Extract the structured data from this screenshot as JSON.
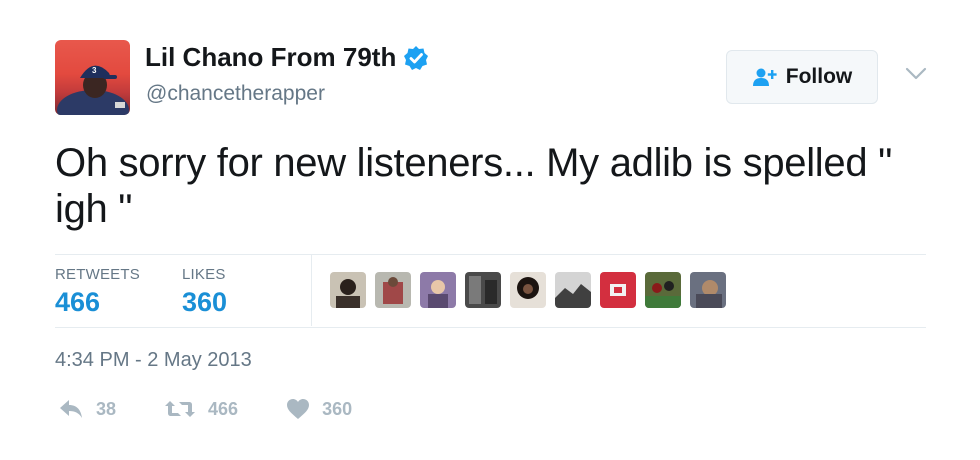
{
  "user": {
    "display_name": "Lil Chano From 79th",
    "handle": "@chancetherapper",
    "verified": true
  },
  "follow_button": {
    "label": "Follow"
  },
  "tweet": {
    "text": "Oh sorry for new listeners... My adlib is spelled \" igh \"",
    "timestamp": "4:34 PM - 2 May 2013"
  },
  "stats": {
    "retweets_label": "RETWEETS",
    "retweets_value": "466",
    "likes_label": "LIKES",
    "likes_value": "360"
  },
  "liked_by": [
    {
      "icon": "liker-avatar"
    },
    {
      "icon": "liker-avatar"
    },
    {
      "icon": "liker-avatar"
    },
    {
      "icon": "liker-avatar"
    },
    {
      "icon": "liker-avatar"
    },
    {
      "icon": "liker-avatar"
    },
    {
      "icon": "liker-avatar"
    },
    {
      "icon": "liker-avatar"
    },
    {
      "icon": "liker-avatar"
    }
  ],
  "actions": {
    "reply_count": "38",
    "retweet_count": "466",
    "like_count": "360"
  },
  "colors": {
    "accent": "#1b95e0",
    "muted": "#657786",
    "action_gray": "#aab8c2",
    "verified_blue": "#1da1f2"
  }
}
